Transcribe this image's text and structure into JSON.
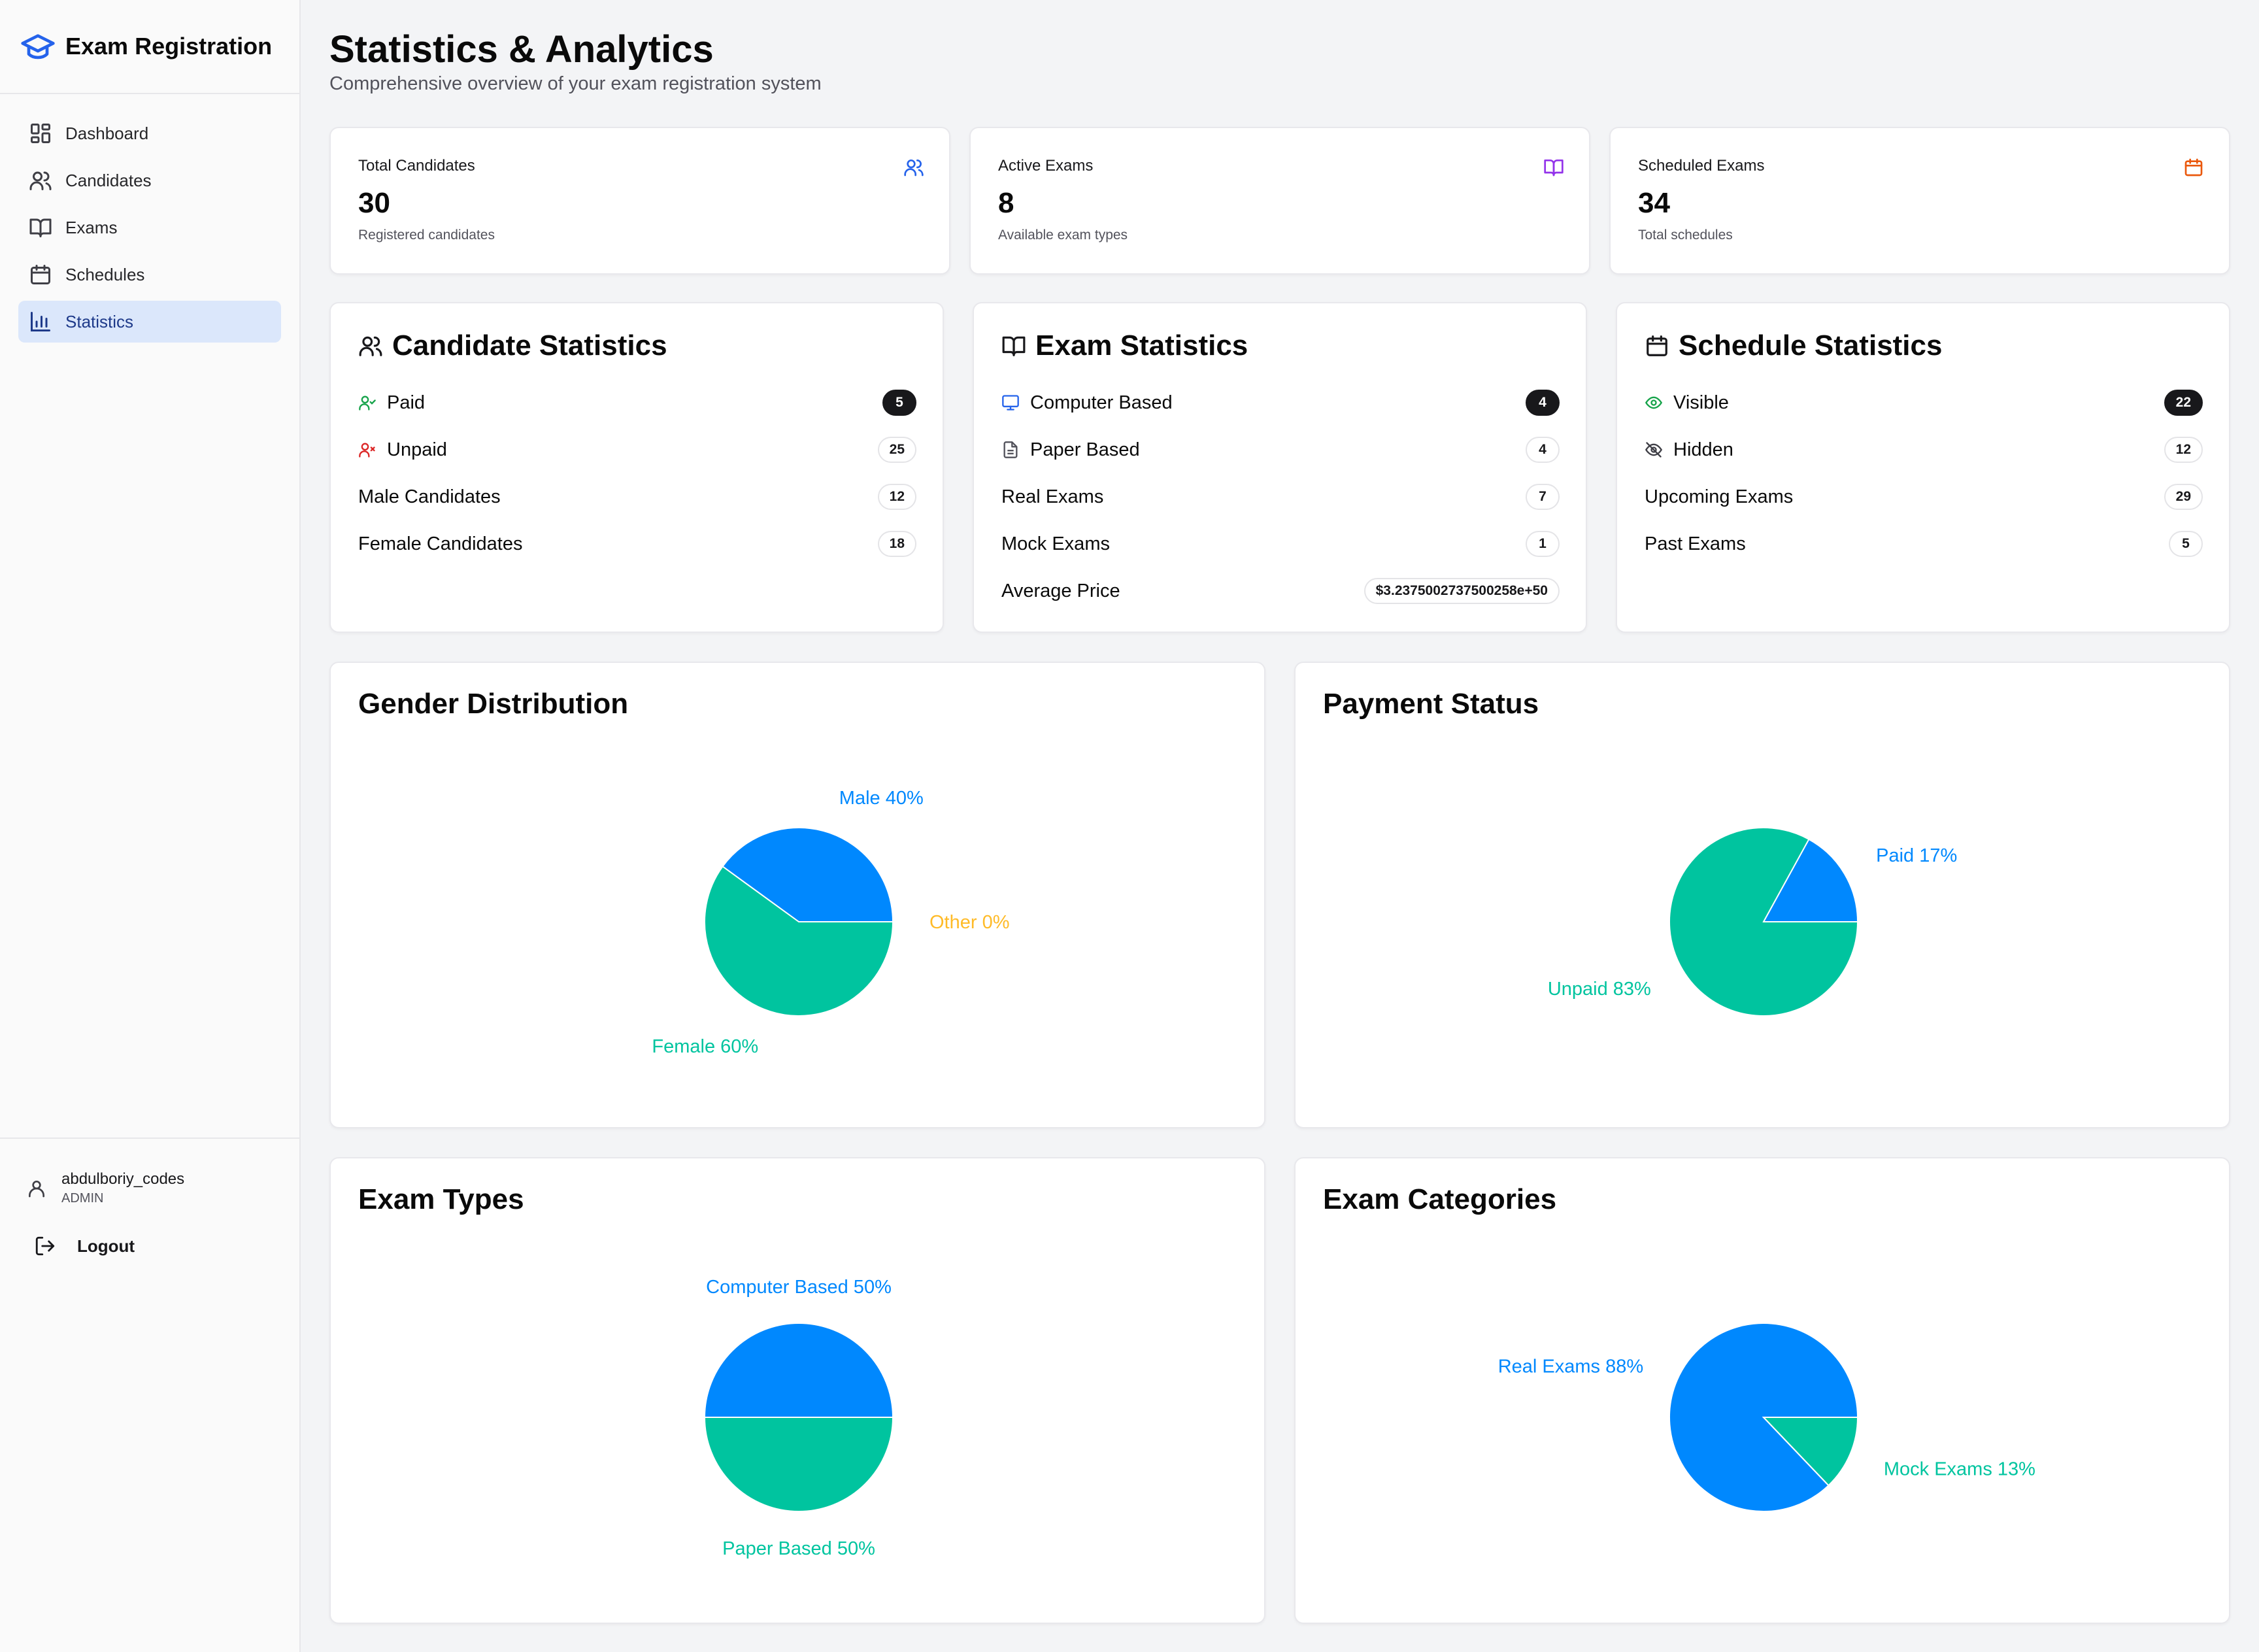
{
  "app": {
    "title": "Exam Registration"
  },
  "sidebar": {
    "items": [
      {
        "label": "Dashboard"
      },
      {
        "label": "Candidates"
      },
      {
        "label": "Exams"
      },
      {
        "label": "Schedules"
      },
      {
        "label": "Statistics"
      }
    ],
    "active": "Statistics",
    "user": {
      "name": "abdulboriy_codes",
      "role": "ADMIN"
    },
    "logout_label": "Logout"
  },
  "page": {
    "title": "Statistics & Analytics",
    "subtitle": "Comprehensive overview of your exam registration system"
  },
  "kpis": [
    {
      "label": "Total Candidates",
      "value": "30",
      "sub": "Registered candidates",
      "icon": "users-icon",
      "color": "#2563eb"
    },
    {
      "label": "Active Exams",
      "value": "8",
      "sub": "Available exam types",
      "icon": "book-icon",
      "color": "#9333ea"
    },
    {
      "label": "Scheduled Exams",
      "value": "34",
      "sub": "Total schedules",
      "icon": "calendar-icon",
      "color": "#ea580c"
    }
  ],
  "candidate_stats": {
    "title": "Candidate Statistics",
    "rows": [
      {
        "label": "Paid",
        "value": "5",
        "icon": "user-check-icon",
        "dark": true
      },
      {
        "label": "Unpaid",
        "value": "25",
        "icon": "user-x-icon",
        "dark": false
      },
      {
        "label": "Male Candidates",
        "value": "12",
        "dark": false
      },
      {
        "label": "Female Candidates",
        "value": "18",
        "dark": false
      }
    ]
  },
  "exam_stats": {
    "title": "Exam Statistics",
    "rows": [
      {
        "label": "Computer Based",
        "value": "4",
        "icon": "monitor-icon",
        "dark": true
      },
      {
        "label": "Paper Based",
        "value": "4",
        "icon": "file-icon",
        "dark": false
      },
      {
        "label": "Real Exams",
        "value": "7",
        "dark": false
      },
      {
        "label": "Mock Exams",
        "value": "1",
        "dark": false
      },
      {
        "label": "Average Price",
        "value": "$3.2375002737500258e+50",
        "dark": false
      }
    ]
  },
  "schedule_stats": {
    "title": "Schedule Statistics",
    "rows": [
      {
        "label": "Visible",
        "value": "22",
        "icon": "eye-icon",
        "dark": true
      },
      {
        "label": "Hidden",
        "value": "12",
        "icon": "eye-off-icon",
        "dark": false
      },
      {
        "label": "Upcoming Exams",
        "value": "29",
        "dark": false
      },
      {
        "label": "Past Exams",
        "value": "5",
        "dark": false
      }
    ]
  },
  "colors": {
    "blue": "#0088fe",
    "green": "#00c49f",
    "yellow": "#ffbb28"
  },
  "chart_data": [
    {
      "type": "pie",
      "title": "Gender Distribution",
      "slices": [
        {
          "label": "Male 40%",
          "value": 40,
          "color": "#0088fe"
        },
        {
          "label": "Female 60%",
          "value": 60,
          "color": "#00c49f"
        },
        {
          "label": "Other 0%",
          "value": 0,
          "color": "#ffbb28"
        }
      ]
    },
    {
      "type": "pie",
      "title": "Payment Status",
      "slices": [
        {
          "label": "Paid 17%",
          "value": 17,
          "color": "#0088fe"
        },
        {
          "label": "Unpaid 83%",
          "value": 83,
          "color": "#00c49f"
        }
      ]
    },
    {
      "type": "pie",
      "title": "Exam Types",
      "slices": [
        {
          "label": "Computer Based 50%",
          "value": 50,
          "color": "#0088fe"
        },
        {
          "label": "Paper Based 50%",
          "value": 50,
          "color": "#00c49f"
        }
      ]
    },
    {
      "type": "pie",
      "title": "Exam Categories",
      "slices": [
        {
          "label": "Real Exams 88%",
          "value": 88,
          "color": "#0088fe"
        },
        {
          "label": "Mock Exams 13%",
          "value": 13,
          "color": "#00c49f"
        }
      ]
    }
  ]
}
